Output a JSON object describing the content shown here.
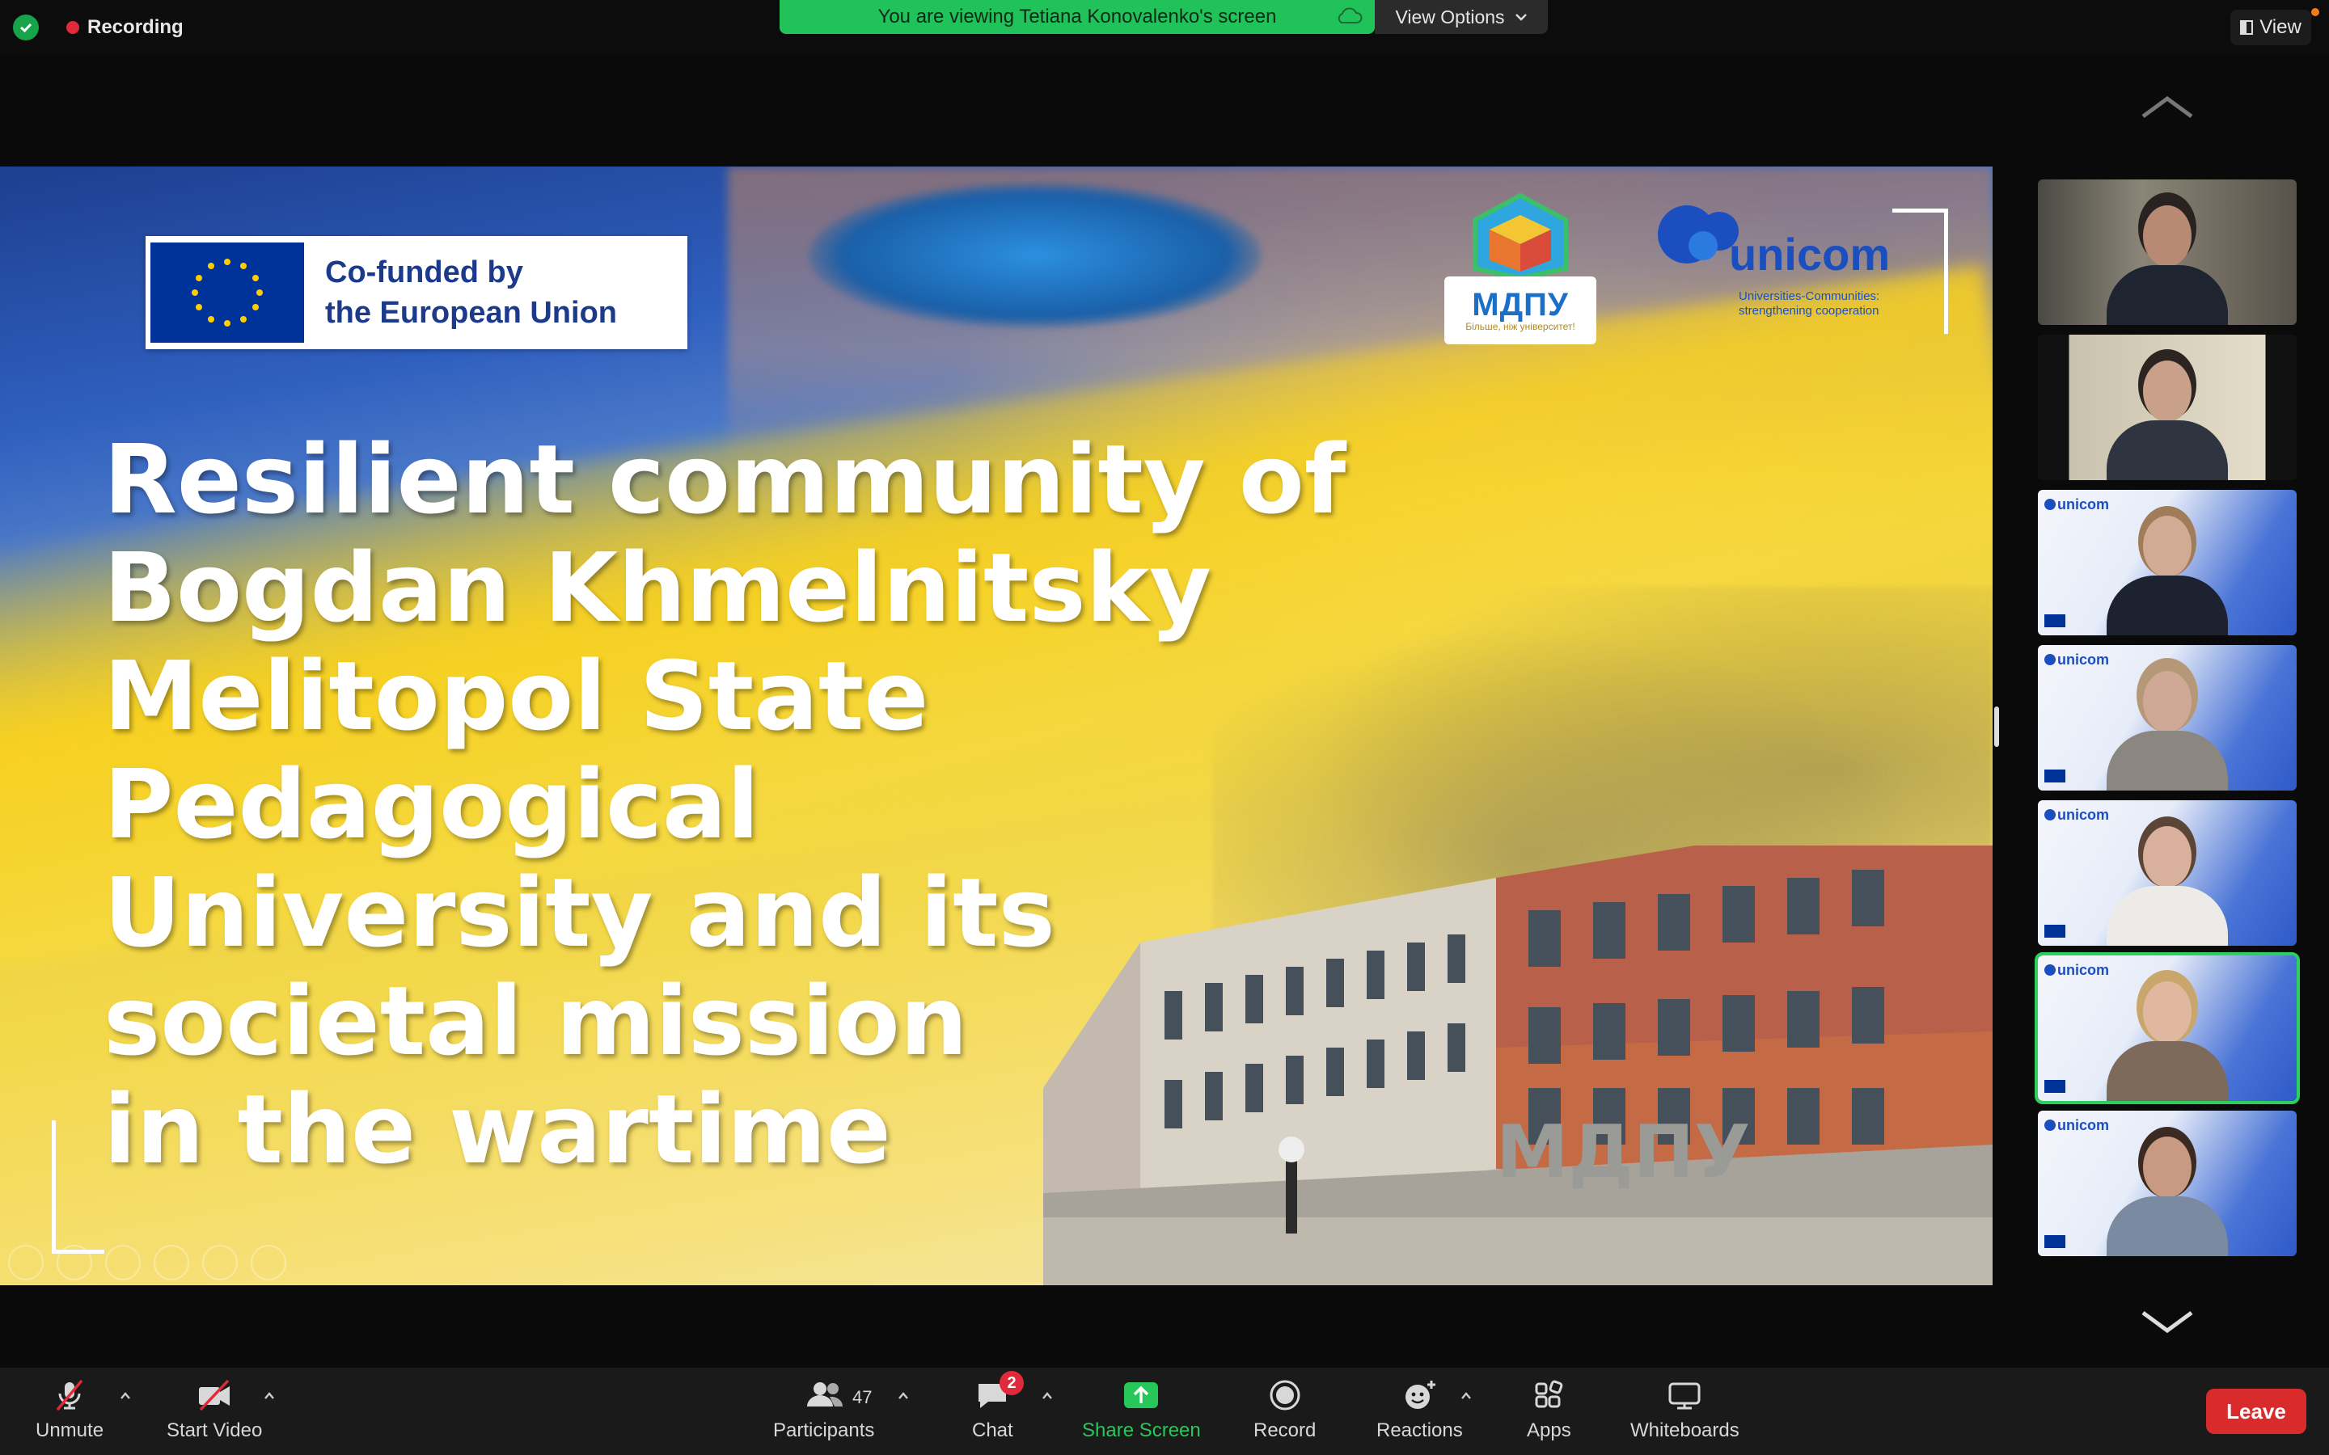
{
  "topbar": {
    "recording_label": "Recording",
    "viewing_banner": "You are viewing Tetiana Konovalenko's screen",
    "view_options_label": "View Options",
    "view_label": "View"
  },
  "slide": {
    "eu_line1": "Co-funded by",
    "eu_line2": "the European Union",
    "mdpu_name": "МДПУ",
    "mdpu_tagline": "Більше, ніж університет!",
    "unicom_name": "unicom",
    "unicom_tagline1": "Universities-Communities:",
    "unicom_tagline2": "strengthening cooperation",
    "title_lines": [
      "Resilient community of",
      "Bogdan Khmelnitsky",
      "Melitopol State",
      "Pedagogical",
      "University and its",
      "societal mission",
      "in the wartime"
    ],
    "building_sign": "МДПУ"
  },
  "gallery": {
    "tiles": [
      {
        "type": "camera",
        "active": false
      },
      {
        "type": "camera",
        "active": false
      },
      {
        "type": "virtual-background",
        "active": false,
        "brand": "unicom"
      },
      {
        "type": "virtual-background",
        "active": false,
        "brand": "unicom"
      },
      {
        "type": "virtual-background",
        "active": false,
        "brand": "unicom"
      },
      {
        "type": "virtual-background",
        "active": true,
        "brand": "unicom"
      },
      {
        "type": "virtual-background",
        "active": false,
        "brand": "unicom"
      }
    ]
  },
  "toolbar": {
    "unmute": "Unmute",
    "start_video": "Start Video",
    "participants": "Participants",
    "participants_count": "47",
    "chat": "Chat",
    "chat_badge": "2",
    "share_screen": "Share Screen",
    "record": "Record",
    "reactions": "Reactions",
    "apps": "Apps",
    "whiteboards": "Whiteboards",
    "leave": "Leave"
  },
  "colors": {
    "share_green": "#27c75a",
    "leave_red": "#d92b2b",
    "active_speaker": "#2bd15c",
    "banner_green": "#21c25a"
  }
}
